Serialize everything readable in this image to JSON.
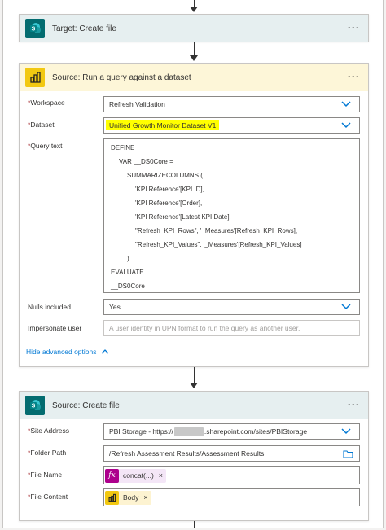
{
  "cards": {
    "target": {
      "title": "Target: Create file",
      "icon": "sharepoint-icon"
    },
    "query": {
      "title": "Source: Run a query against a dataset",
      "icon": "powerbi-icon",
      "fields": {
        "workspace": {
          "label": "Workspace",
          "value": "Refresh Validation"
        },
        "dataset": {
          "label": "Dataset",
          "value": "Unified Growth Monitor Dataset V1"
        },
        "query_text": {
          "label": "Query text",
          "lines": [
            "DEFINE",
            "VAR __DS0Core =",
            "SUMMARIZECOLUMNS (",
            "'KPI Reference'[KPI ID],",
            "'KPI Reference'[Order],",
            "'KPI Reference'[Latest KPI Date],",
            "\"Refresh_KPI_Rows\", '_Measures'[Refresh_KPI_Rows],",
            "\"Refresh_KPI_Values\", '_Measures'[Refresh_KPI_Values]",
            ")",
            "EVALUATE",
            "__DS0Core"
          ]
        },
        "nulls": {
          "label": "Nulls included",
          "value": "Yes"
        },
        "impersonate": {
          "label": "Impersonate user",
          "placeholder": "A user identity in UPN format to run the query as another user."
        }
      },
      "advanced_link": "Hide advanced options"
    },
    "create": {
      "title": "Source: Create file",
      "icon": "sharepoint-icon",
      "fields": {
        "site": {
          "label": "Site Address",
          "prefix": "PBI Storage - https://",
          "suffix": ".sharepoint.com/sites/PBIStorage"
        },
        "folder": {
          "label": "Folder Path",
          "value": "/Refresh Assessment Results/Assessment Results"
        },
        "filename": {
          "label": "File Name",
          "token": "concat(...)"
        },
        "content": {
          "label": "File Content",
          "token": "Body"
        }
      }
    }
  },
  "required_marker": "*",
  "more_glyph": "···",
  "remove_glyph": "×",
  "expression_glyph": "fx",
  "colors": {
    "sharepoint": "#036c70",
    "powerbi": "#f2c811",
    "link": "#0078d4",
    "highlight": "#ffff00"
  }
}
